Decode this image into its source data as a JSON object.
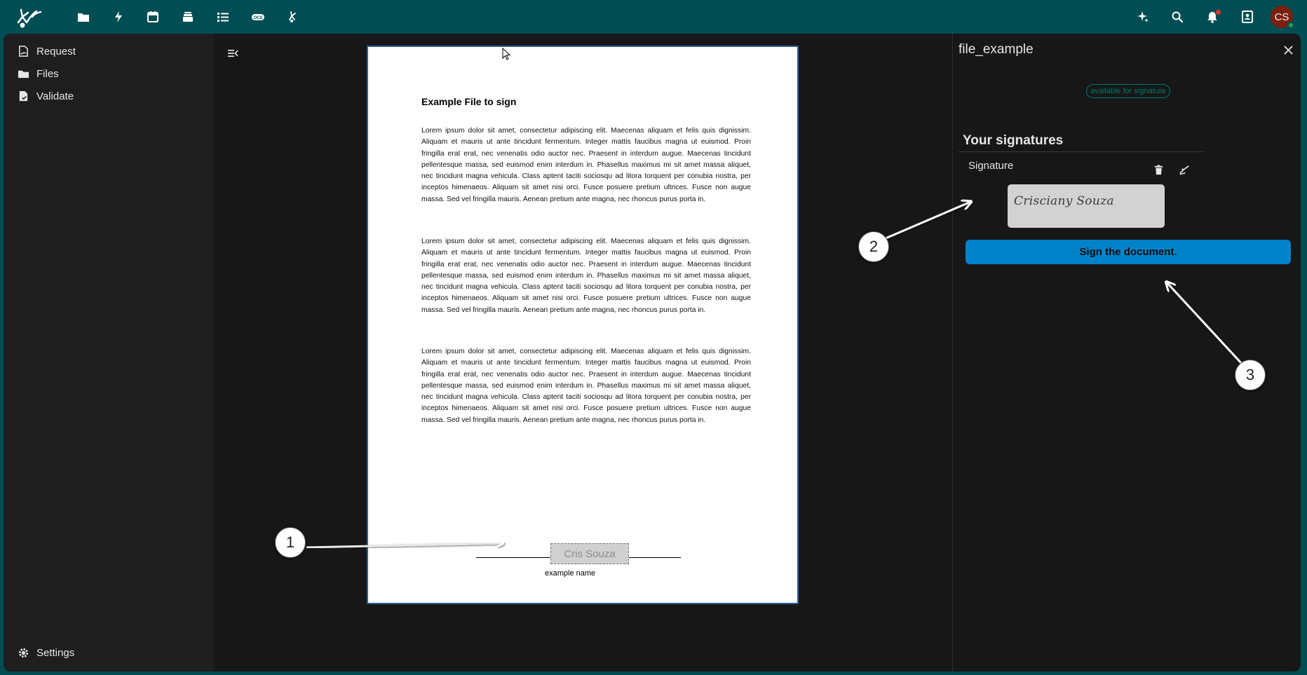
{
  "topbar": {
    "apps": [
      {
        "name": "files-app-icon",
        "label": "Files"
      },
      {
        "name": "activity-app-icon",
        "label": "Activity"
      },
      {
        "name": "calendar-app-icon",
        "label": "Calendar"
      },
      {
        "name": "deck-app-icon",
        "label": "Deck"
      },
      {
        "name": "tasks-app-icon",
        "label": "Tasks"
      },
      {
        "name": "ocs-app-icon",
        "label": "OCS"
      },
      {
        "name": "libresign-app-icon",
        "label": "LibreSign"
      }
    ],
    "avatar_initials": "CS"
  },
  "leftnav": {
    "items": [
      {
        "label": "Request",
        "icon": "file-sign-icon"
      },
      {
        "label": "Files",
        "icon": "folder-icon"
      },
      {
        "label": "Validate",
        "icon": "file-check-icon"
      }
    ],
    "settings_label": "Settings"
  },
  "document": {
    "title": "Example File to sign",
    "paragraphs": [
      "Lorem ipsum dolor sit amet, consectetur adipiscing elit. Maecenas aliquam et felis quis dignissim. Aliquam et mauris ut ante tincidunt fermentum. Integer mattis faucibus magna ut euismod. Proin fringilla erat erat, nec venenatis odio auctor nec. Praesent in interdum augue. Maecenas tincidunt pellentesque massa, sed euismod enim interdum in. Phasellus maximus mi sit amet massa aliquet, nec tincidunt magna vehicula. Class aptent taciti sociosqu ad litora torquent per conubia nostra, per inceptos himenaeos. Aliquam sit amet nisi orci. Fusce posuere pretium ultrices. Fusce non augue massa. Sed vel fringilla mauris. Aenean pretium ante magna, nec rhoncus purus porta in.",
      "Lorem ipsum dolor sit amet, consectetur adipiscing elit. Maecenas aliquam et felis quis dignissim. Aliquam et mauris ut ante tincidunt fermentum. Integer mattis faucibus magna ut euismod. Proin fringilla erat erat, nec venenatis odio auctor nec. Praesent in interdum augue. Maecenas tincidunt pellentesque massa, sed euismod enim interdum in. Phasellus maximus mi sit amet massa aliquet, nec tincidunt magna vehicula. Class aptent taciti sociosqu ad litora torquent per conubia nostra, per inceptos himenaeos. Aliquam sit amet nisi orci. Fusce posuere pretium ultrices. Fusce non augue massa. Sed vel fringilla mauris. Aenean pretium ante magna, nec rhoncus purus porta in.",
      "Lorem ipsum dolor sit amet, consectetur adipiscing elit. Maecenas aliquam et felis quis dignissim. Aliquam et mauris ut ante tincidunt fermentum. Integer mattis faucibus magna ut euismod. Proin fringilla erat erat, nec venenatis odio auctor nec. Praesent in interdum augue. Maecenas tincidunt pellentesque massa, sed euismod enim interdum in. Phasellus maximus mi sit amet massa aliquet, nec tincidunt magna vehicula. Class aptent taciti sociosqu ad litora torquent per conubia nostra, per inceptos himenaeos. Aliquam sit amet nisi orci. Fusce posuere pretium ultrices. Fusce non augue massa. Sed vel fringilla mauris. Aenean pretium ante magna, nec rhoncus purus porta in."
    ],
    "signature_placeholder": "Cris Souza",
    "signature_caption": "example name"
  },
  "sidebar": {
    "file_name": "file_example",
    "status_badge": "available for signature",
    "signatures_heading": "Your signatures",
    "signature_label": "Signature",
    "signature_preview_text": "Crisciany Souza",
    "sign_button_label": "Sign the document."
  },
  "annotations": {
    "callouts": [
      "1",
      "2",
      "3"
    ]
  },
  "colors": {
    "header_bg": "#004e54",
    "accent": "#0082c9",
    "badge": "#00796b"
  }
}
